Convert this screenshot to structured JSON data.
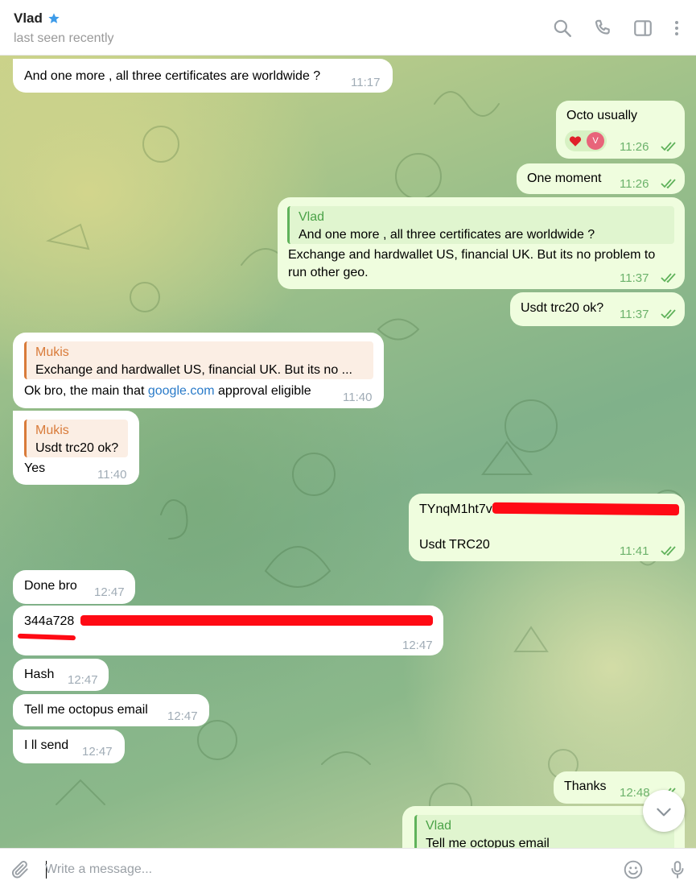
{
  "header": {
    "contact_name": "Vlad",
    "status": "last seen recently",
    "icons": [
      "search-icon",
      "phone-icon",
      "sidebar-toggle-icon",
      "more-vertical-icon"
    ]
  },
  "messages": {
    "m1": {
      "text": "And one more , all three certificates are worldwide ?",
      "time": "11:17"
    },
    "m2": {
      "text": "Octo usually",
      "reactions": [
        "❤️",
        "V"
      ],
      "time": "11:26"
    },
    "m3": {
      "text": "One moment",
      "time": "11:26"
    },
    "m4": {
      "reply_name": "Vlad",
      "reply_text": "And one more , all three certificates are worldwide ?",
      "line1": "Exchange and hardwallet US, financial UK. But its no problem to",
      "line2": "run other geo.",
      "time": "11:37"
    },
    "m5": {
      "text": "Usdt trc20 ok?",
      "time": "11:37"
    },
    "m6": {
      "reply_name": "Mukis",
      "reply_text": "Exchange and hardwallet US, financial UK. But its no ...",
      "text_before": "Ok bro, the main that ",
      "link": "google.com",
      "text_after": " approval eligible",
      "time": "11:40"
    },
    "m7": {
      "reply_name": "Mukis",
      "reply_text": "Usdt trc20 ok?",
      "text": "Yes",
      "time": "11:40"
    },
    "m8": {
      "line1": "TYnqM1ht7v",
      "line2": "Usdt TRC20",
      "time": "11:41"
    },
    "m9": {
      "text": "Done bro",
      "time": "12:47"
    },
    "m10": {
      "text": "344a728",
      "time": "12:47"
    },
    "m11": {
      "text": "Hash",
      "time": "12:47"
    },
    "m12": {
      "text": "Tell me octopus email",
      "time": "12:47"
    },
    "m13": {
      "text": "I ll send",
      "time": "12:47"
    },
    "m14": {
      "text": "Thanks",
      "time": "12:48"
    },
    "m15": {
      "reply_name": "Vlad",
      "reply_text": "Tell me octopus email"
    }
  },
  "composer": {
    "placeholder": "Write a message...",
    "icons": [
      "attach-icon",
      "emoji-icon",
      "microphone-icon"
    ]
  },
  "colors": {
    "outgoing_bubble": "#effdde",
    "incoming_bubble": "#ffffff",
    "accent_green": "#4aa247",
    "reply_orange": "#d97b3a",
    "link_blue": "#2a7bc9",
    "star_blue": "#3d9be9"
  }
}
